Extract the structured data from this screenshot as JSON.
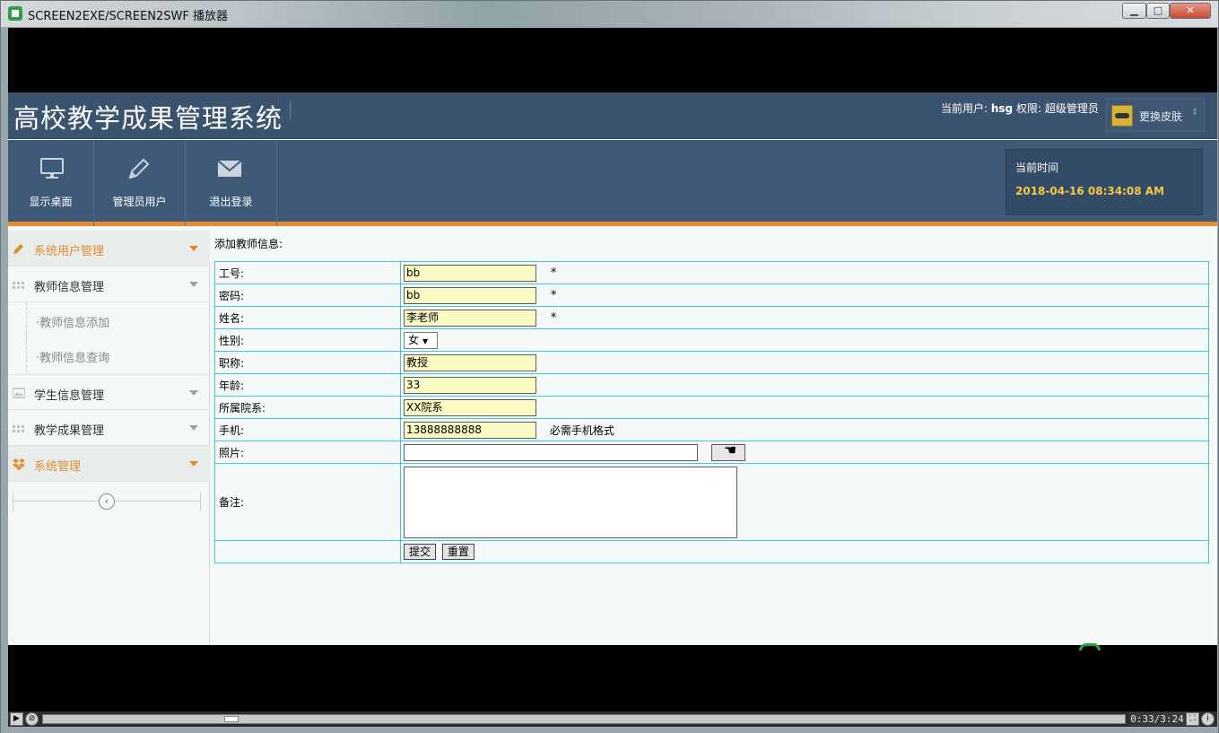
{
  "window": {
    "title": "SCREEN2EXE/SCREEN2SWF 播放器",
    "min_icon": "minimize-icon",
    "max_icon": "maximize-icon",
    "close_icon": "close-icon",
    "min_glyph": "▁",
    "max_glyph": "□",
    "close_glyph": "✕"
  },
  "header": {
    "site_title": "高校教学成果管理系统",
    "user_label": "当前用户:",
    "user_name": "hsg",
    "role_label": "权限:",
    "role_name": "超级管理员",
    "skin_label": "更换皮肤",
    "skin_arrow": "⇕"
  },
  "toolbar": {
    "items": [
      {
        "label": "显示桌面",
        "icon": "monitor-icon"
      },
      {
        "label": "管理员用户",
        "icon": "pencil-icon"
      },
      {
        "label": "退出登录",
        "icon": "envelope-icon"
      }
    ],
    "time_label": "当前时间",
    "time_value": "2018-04-16 08:34:08 AM"
  },
  "sidebar": {
    "items": [
      {
        "label": "系统用户管理",
        "icon": "pencil-icon",
        "active": true
      },
      {
        "label": "教师信息管理",
        "icon": "grid-icon",
        "active": false
      },
      {
        "label": "学生信息管理",
        "icon": "image-icon",
        "active": false
      },
      {
        "label": "教学成果管理",
        "icon": "grid-icon",
        "active": false
      },
      {
        "label": "系统管理",
        "icon": "dropbox-icon",
        "active": true
      }
    ],
    "subitems": [
      {
        "label": "·教师信息添加"
      },
      {
        "label": "·教师信息查询"
      }
    ],
    "collapse_glyph": "‹"
  },
  "form": {
    "heading": "添加教师信息:",
    "rows": {
      "job_no": {
        "label": "工号:",
        "value": "bb",
        "required": "*"
      },
      "password": {
        "label": "密码:",
        "value": "bb",
        "required": "*"
      },
      "name": {
        "label": "姓名:",
        "value": "李老师",
        "required": "*"
      },
      "gender": {
        "label": "性别:",
        "value": "女",
        "caret": "▼"
      },
      "title": {
        "label": "职称:",
        "value": "教授"
      },
      "age": {
        "label": "年龄:",
        "value": "33"
      },
      "dept": {
        "label": "所属院系:",
        "value": "XX院系"
      },
      "phone": {
        "label": "手机:",
        "value": "13888888888",
        "hint": "必需手机格式"
      },
      "photo": {
        "label": "照片:",
        "value": ""
      },
      "remark": {
        "label": "备注:",
        "value": ""
      }
    },
    "submit_label": "提交",
    "reset_label": "重置"
  },
  "player": {
    "play_glyph": "▶",
    "time_readout": "0:33/3:24",
    "progress": 0.17,
    "fullscreen_icon": "fullscreen-icon",
    "info_icon": "info-icon"
  }
}
